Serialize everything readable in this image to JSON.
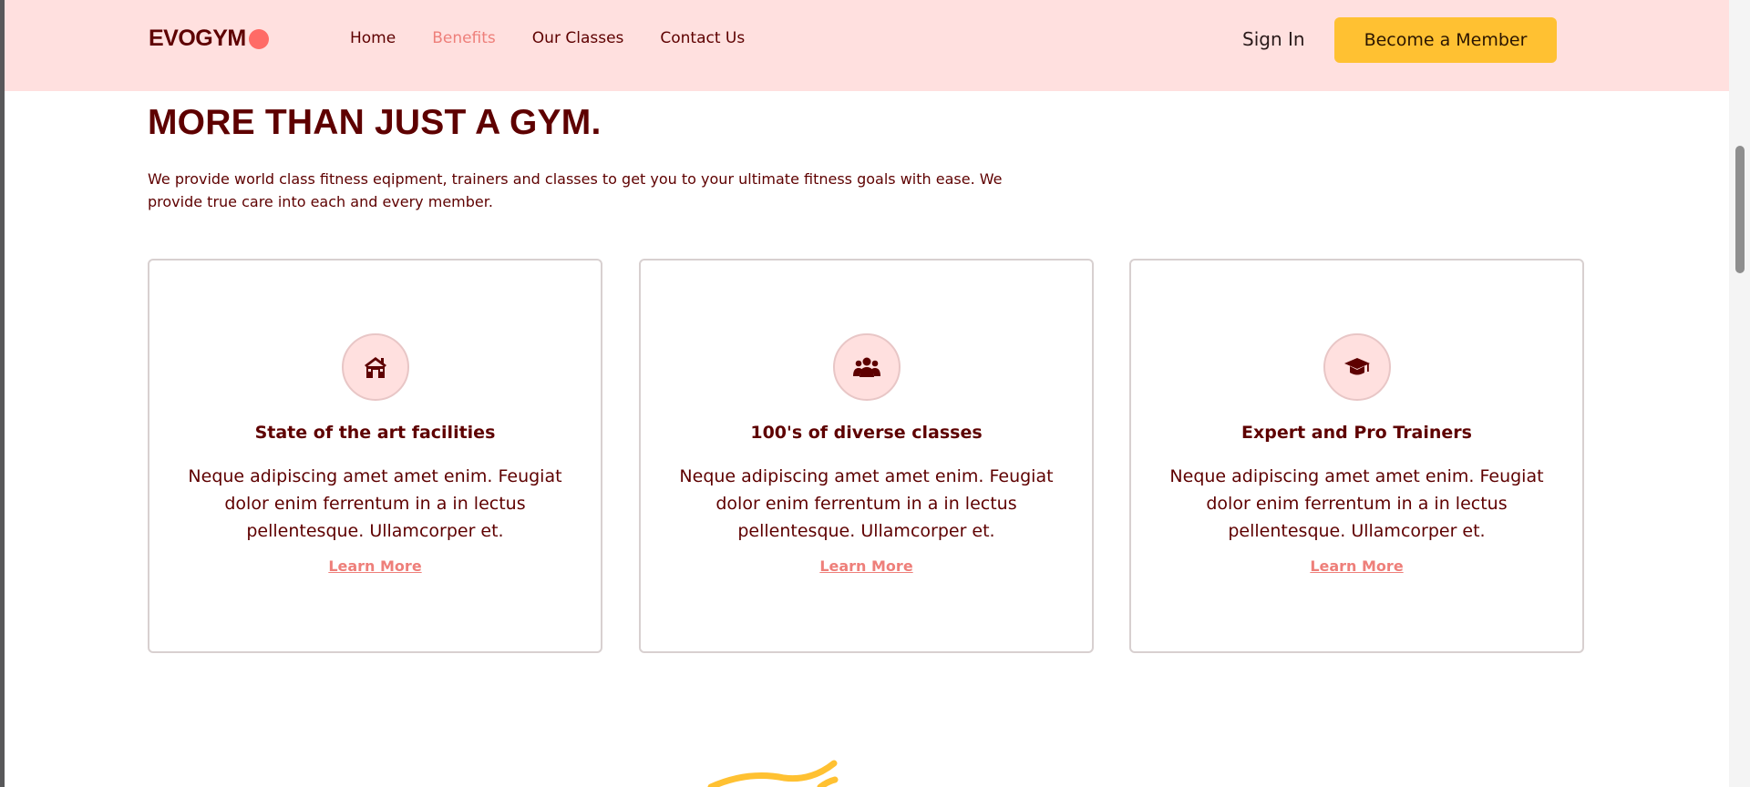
{
  "brand": {
    "name": "EVOGYM",
    "accent": "#ff6b66"
  },
  "nav": {
    "links": [
      {
        "label": "Home",
        "active": false
      },
      {
        "label": "Benefits",
        "active": true
      },
      {
        "label": "Our Classes",
        "active": false
      },
      {
        "label": "Contact Us",
        "active": false
      }
    ],
    "sign_in": "Sign In",
    "cta": "Become a Member"
  },
  "benefits": {
    "headline": "MORE THAN JUST A GYM.",
    "intro": "We provide world class fitness eqipment, trainers and classes to get you to your ultimate fitness goals with ease. We provide true care into each and every member.",
    "cards": [
      {
        "icon": "home-icon",
        "title": "State of the art facilities",
        "text": "Neque adipiscing amet amet enim. Feugiat dolor enim ferrentum in a in lectus pellentesque. Ullamcorper et.",
        "link": "Learn More"
      },
      {
        "icon": "user-group-icon",
        "title": "100's of diverse classes",
        "text": "Neque adipiscing amet amet enim. Feugiat dolor enim ferrentum in a in lectus pellentesque. Ullamcorper et.",
        "link": "Learn More"
      },
      {
        "icon": "graduation-cap-icon",
        "title": "Expert and Pro Trainers",
        "text": "Neque adipiscing amet amet enim. Feugiat dolor enim ferrentum in a in lectus pellentesque. Ullamcorper et.",
        "link": "Learn More"
      }
    ]
  },
  "colors": {
    "primary": "#5e0000",
    "nav_bg": "#ffe0df",
    "cta_bg": "#ffc132",
    "link": "#ee7f7a"
  }
}
